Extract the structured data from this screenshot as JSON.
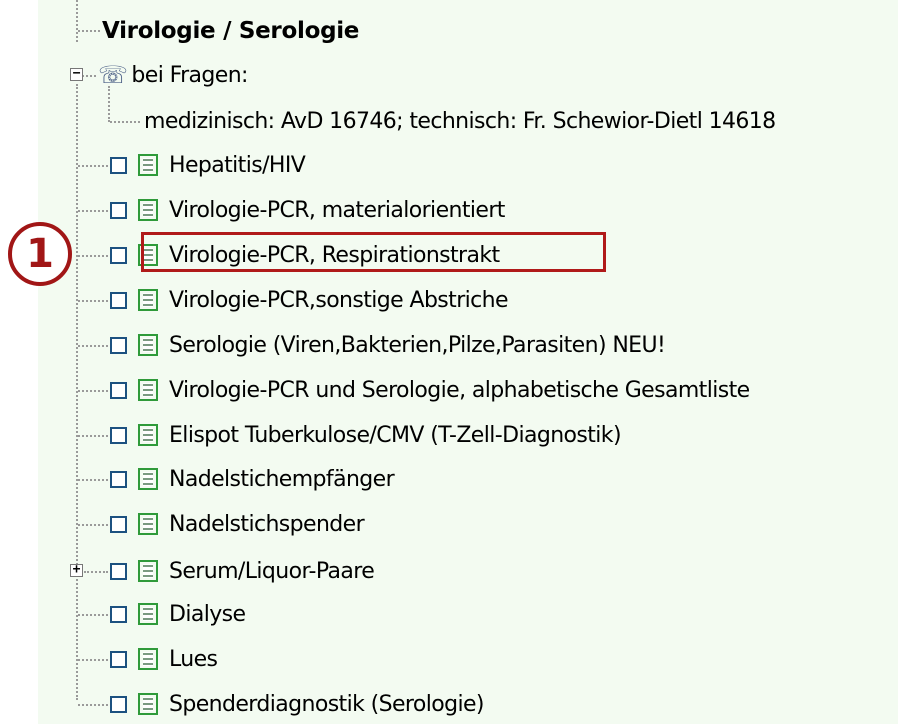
{
  "tree": {
    "title": "Virologie / Serologie",
    "question": {
      "label": "bei Fragen:",
      "detail": "medizinisch: AvD 16746; technisch: Fr. Schewior-Dietl 14618"
    },
    "items": [
      {
        "label": "Hepatitis/HIV"
      },
      {
        "label": "Virologie-PCR, materialorientiert"
      },
      {
        "label": "Virologie-PCR, Respirationstrakt"
      },
      {
        "label": "Virologie-PCR,sonstige Abstriche"
      },
      {
        "label": "Serologie (Viren,Bakterien,Pilze,Parasiten) NEU!"
      },
      {
        "label": "Virologie-PCR und Serologie, alphabetische Gesamtliste"
      },
      {
        "label": "Elispot Tuberkulose/CMV (T-Zell-Diagnostik)"
      },
      {
        "label": "Nadelstichempfänger"
      },
      {
        "label": "Nadelstichspender"
      },
      {
        "label": "Serum/Liquor-Paare"
      },
      {
        "label": "Dialyse"
      },
      {
        "label": "Lues"
      },
      {
        "label": "Spenderdiagnostik (Serologie)"
      }
    ]
  },
  "annotation": {
    "step_number": "1"
  },
  "icons": {
    "phone": "telephone-icon",
    "document": "document-icon",
    "collapse": "minus-box",
    "expand": "plus-box"
  },
  "colors": {
    "tree_background": "#f3fbf1",
    "checkbox_border": "#1c5180",
    "document_icon": "#2f9a3a",
    "highlight": "#b01a1a"
  }
}
